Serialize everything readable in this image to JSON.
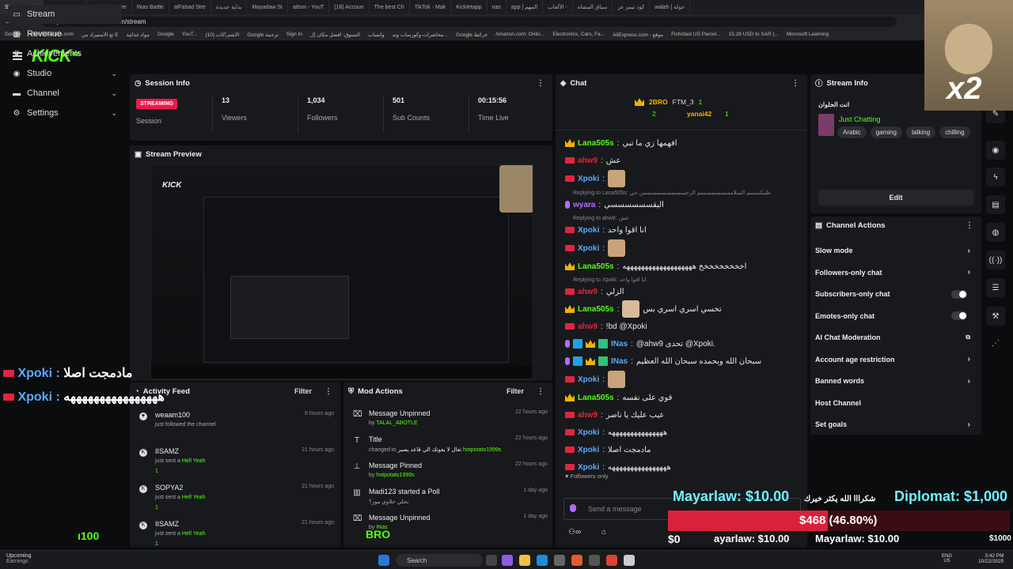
{
  "browser": {
    "tabs": [
      "Stream - Kick",
      "a8sm Stream",
      "Gherri 10 Stre",
      "INas Battle",
      "alFahad Stre",
      "بداية جديدة",
      "Mayarlaw St",
      "a8sm - YouT",
      "(18) Accoun",
      "The best Ch",
      "TikTok - Mak",
      "Kickletapp",
      "nas",
      "app | المهم",
      "الألعاب -",
      "سباق المشاه",
      "كود تيمز عر",
      "walah | جولة"
    ],
    "url": "https://dashboard.kick.com/stream",
    "bookmarks": [
      "Google",
      "wheelofnames.com",
      "ثغ الاستيراد من E",
      "مواد غذائية",
      "Google",
      "YouT...",
      "(10) الاشتراكات",
      "Google ترجمة",
      "Sign In",
      "التسوق: افضل مكان إل",
      "واتساب",
      "محاضرات وكورسات وند...",
      "Google خرائط",
      "Amazon.com: Onlin...",
      "Electronics, Cars, Fa...",
      "AliExpress.com - موقع",
      "Fishsfast US Parcel...",
      "15.28 USD to SAR |...",
      "Microsoft Learning"
    ]
  },
  "sidebar": {
    "logo": "KICK",
    "logo_beta": "BETA",
    "items": [
      {
        "label": "Stream",
        "icon": "monitor-icon",
        "active": true
      },
      {
        "label": "Revenue",
        "icon": "revenue-icon"
      },
      {
        "label": "Achievements",
        "icon": "trophy-icon"
      },
      {
        "label": "Studio",
        "icon": "studio-icon",
        "expand": true
      },
      {
        "label": "Channel",
        "icon": "channel-icon",
        "expand": true
      },
      {
        "label": "Settings",
        "icon": "gear-icon",
        "expand": true
      }
    ]
  },
  "session": {
    "title": "Session Info",
    "status": "STREAMING",
    "status_label": "Session",
    "viewers": "13",
    "viewers_label": "Viewers",
    "followers": "1,034",
    "followers_label": "Followers",
    "subs": "501",
    "subs_label": "Sub Counts",
    "time": "00:15:56",
    "time_label": "Time Live"
  },
  "preview": {
    "title": "Stream Preview"
  },
  "activity": {
    "title": "Activity Feed",
    "filter": "Filter",
    "items": [
      {
        "name": "weaam100",
        "desc": "just followed the channel",
        "kick": "",
        "time": "8 hours ago",
        "icon": "heart-icon"
      },
      {
        "name": "IISAMZ",
        "desc": "just sent a",
        "gift": "Hell Yeah",
        "kick": "1",
        "time": "21 hours ago",
        "icon": "kick-icon"
      },
      {
        "name": "SOPYA2",
        "desc": "just sent a",
        "gift": "Hell Yeah",
        "kick": "1",
        "time": "21 hours ago",
        "icon": "kick-icon"
      },
      {
        "name": "IISAMZ",
        "desc": "just sent a",
        "gift": "Hell Yeah",
        "kick": "1",
        "time": "21 hours ago",
        "icon": "kick-icon"
      }
    ]
  },
  "mod": {
    "title": "Mod Actions",
    "filter": "Filter",
    "items": [
      {
        "name": "Message Unpinned",
        "desc": "by",
        "who": "TALAL_ABOTLE",
        "time": "22 hours ago"
      },
      {
        "name": "Title",
        "desc": "changed to",
        "extra": "تعال لا يفوتك الي قاعد يصير",
        "who": "hotpotato1999s",
        "time": "22 hours ago"
      },
      {
        "name": "Message Pinned",
        "desc": "by",
        "who": "hotpotato1999s",
        "time": "22 hours ago"
      },
      {
        "name": "Madi123 started a Poll",
        "desc": "نحلي حلاوي موز؟",
        "who": "",
        "time": "1 day ago"
      },
      {
        "name": "Message Unpinned",
        "desc": "by",
        "who": "INas",
        "time": "1 day ago"
      }
    ]
  },
  "chat": {
    "title": "Chat",
    "top": {
      "u1": "2BRO",
      "c1": "2",
      "u2": "FTM_3",
      "c2": "1",
      "u3": "yanai42",
      "c3": "1"
    },
    "messages": [
      {
        "user": "Lana505s",
        "color": "#53fc18",
        "text": "افهمها زي ما تبي",
        "badge": "crown"
      },
      {
        "user": "ahw9",
        "color": "#e0253f",
        "text": "عش",
        "badge": "red"
      },
      {
        "user": "Xpoki",
        "color": "#5aa9ff",
        "text": "",
        "badge": "red",
        "emote": true
      },
      {
        "user": "wyara",
        "color": "#b06cff",
        "text": "اليقسسسسسسي",
        "badge": "mic",
        "reply": "Replying to Lana505s: علينكسسم السلامسسسسسسم الرحسسسسسسسسس حي"
      },
      {
        "user": "Xpoki",
        "color": "#5aa9ff",
        "text": "انا اقوا واحد",
        "badge": "red",
        "reply": "Replying to ahw9: عش"
      },
      {
        "user": "Xpoki",
        "color": "#5aa9ff",
        "text": "",
        "badge": "red",
        "emote": true
      },
      {
        "user": "Lana505s",
        "color": "#53fc18",
        "text": "اخخخخخخخخخ هههههههههههههههههههه",
        "badge": "crown"
      },
      {
        "user": "ahw9",
        "color": "#e0253f",
        "text": "الزلي",
        "badge": "red",
        "reply": "Replying to Xpoki: انا اقوا واحد"
      },
      {
        "user": "Lana505s",
        "color": "#53fc18",
        "text": "تخسي اسري اسري بس",
        "badge": "crown",
        "emote": true
      },
      {
        "user": "ahw9",
        "color": "#e0253f",
        "text": "!bd @Xpoki",
        "badge": "red"
      },
      {
        "user": "INas",
        "color": "#5aa9ff",
        "text": "@ahw9 تحدى @Xpoki.",
        "badge": "multi"
      },
      {
        "user": "INas",
        "color": "#5aa9ff",
        "text": "سبحان الله وبحمده سبحان الله العظيم",
        "badge": "multi"
      },
      {
        "user": "Xpoki",
        "color": "#5aa9ff",
        "text": "",
        "badge": "red",
        "emote": true
      },
      {
        "user": "Lana505s",
        "color": "#53fc18",
        "text": "قوي على نفسه",
        "badge": "crown"
      },
      {
        "user": "ahw9",
        "color": "#e0253f",
        "text": "عيب عليك يا ناصر",
        "badge": "red"
      },
      {
        "user": "Xpoki",
        "color": "#5aa9ff",
        "text": "هههههههههههههههه",
        "badge": "red"
      },
      {
        "user": "Xpoki",
        "color": "#5aa9ff",
        "text": "مادمجت اصلا",
        "badge": "red"
      },
      {
        "user": "Xpoki",
        "color": "#5aa9ff",
        "text": "ههههههههههههههههه",
        "badge": "red"
      }
    ],
    "followers_only": "Followers only",
    "placeholder": "Send a message"
  },
  "stream_info": {
    "title": "Stream Info",
    "name": "انت الحلوان",
    "category": "Just Chatting",
    "tags": [
      "Arabic",
      "gaming",
      "talking",
      "chilling"
    ],
    "edit": "Edit"
  },
  "channel_actions": {
    "title": "Channel Actions",
    "items": [
      {
        "label": "Slow mode",
        "kind": "chev"
      },
      {
        "label": "Followers-only chat",
        "kind": "chev"
      },
      {
        "label": "Subscribers-only chat",
        "kind": "toggle"
      },
      {
        "label": "Emotes-only chat",
        "kind": "toggle"
      },
      {
        "label": "AI Chat Moderation",
        "kind": "ext"
      },
      {
        "label": "Account age restriction",
        "kind": "chev"
      },
      {
        "label": "Banned words",
        "kind": "chev"
      },
      {
        "label": "Host Channel",
        "kind": "none"
      },
      {
        "label": "Set goals",
        "kind": "chev"
      }
    ]
  },
  "overlay": {
    "left1_user": "Xpoki :",
    "left1_text": "مادمجت اصلا",
    "left2_user": "Xpoki :",
    "left2_text": "ههههههههههههههههه",
    "bottom_left": "ı100",
    "bro": "BRO",
    "x2": "x2",
    "arabic_thanks": "شكرااا الله يكثر خيرك",
    "mayar": "Mayarlaw: $10.00",
    "diplomat": "Diplomat: $1,000",
    "goal": "$468 (46.80%)",
    "goal_fraction": 0.468,
    "zero": "$0",
    "ayar": "ayarlaw: $10.00",
    "mayar2": "Mayarlaw: $10.00",
    "thousand": "$1000"
  },
  "taskbar": {
    "upcoming": "Upcoming",
    "earnings": "Earnings",
    "search": "Search",
    "lang1": "ENG",
    "lang2": "US",
    "time": "3:42 PM",
    "date": "10/22/2025"
  }
}
